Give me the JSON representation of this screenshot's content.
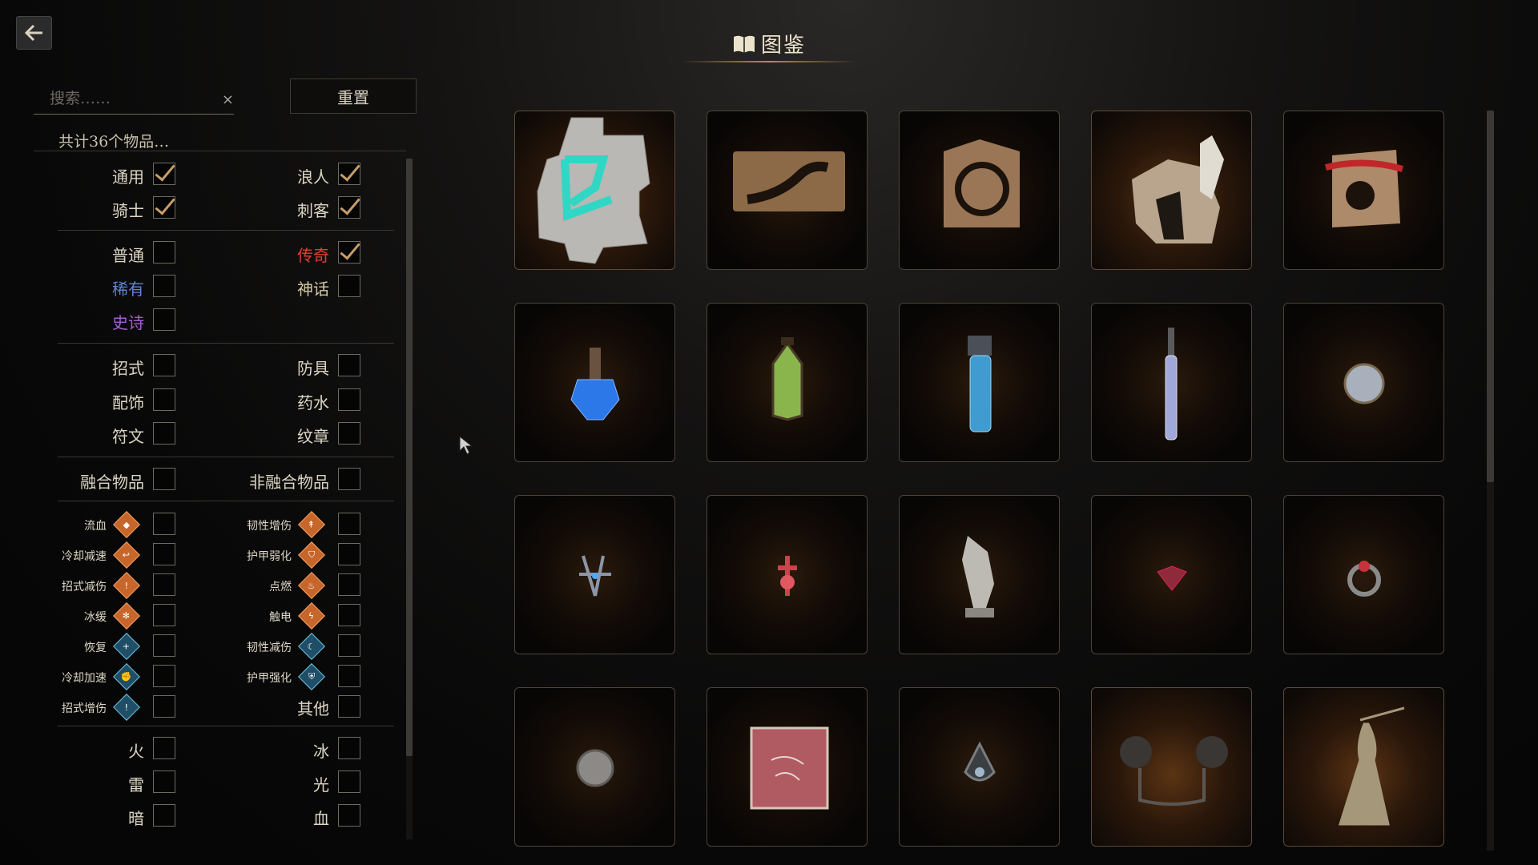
{
  "header": {
    "title": "图鉴",
    "title_icon": "book-icon",
    "back_icon": "back-arrow-icon"
  },
  "search": {
    "placeholder": "搜索……",
    "value": "",
    "clear_glyph": "×"
  },
  "reset_label": "重置",
  "count_label": "共计36个物品…",
  "filters": {
    "class": [
      {
        "label": "通用",
        "checked": true
      },
      {
        "label": "浪人",
        "checked": true
      },
      {
        "label": "骑士",
        "checked": true
      },
      {
        "label": "刺客",
        "checked": true
      }
    ],
    "rarity": [
      {
        "label": "普通",
        "checked": false
      },
      {
        "label": "传奇",
        "checked": true
      },
      {
        "label": "稀有",
        "checked": false
      },
      {
        "label": "神话",
        "checked": false
      },
      {
        "label": "史诗",
        "checked": false
      }
    ],
    "type": [
      {
        "label": "招式",
        "checked": false
      },
      {
        "label": "防具",
        "checked": false
      },
      {
        "label": "配饰",
        "checked": false
      },
      {
        "label": "药水",
        "checked": false
      },
      {
        "label": "符文",
        "checked": false
      },
      {
        "label": "纹章",
        "checked": false
      }
    ],
    "fusion": [
      {
        "label": "融合物品",
        "checked": false
      },
      {
        "label": "非融合物品",
        "checked": false
      }
    ],
    "effects": [
      {
        "label": "流血",
        "icon": "bleed-icon",
        "color": "#c7662b",
        "checked": false
      },
      {
        "label": "韧性增伤",
        "icon": "poise-damage-icon",
        "color": "#c7662b",
        "checked": false
      },
      {
        "label": "冷却减速",
        "icon": "cooldown-slow-icon",
        "color": "#c7662b",
        "checked": false
      },
      {
        "label": "护甲弱化",
        "icon": "armor-weaken-icon",
        "color": "#c7662b",
        "checked": false
      },
      {
        "label": "招式减伤",
        "icon": "skill-reduce-icon",
        "color": "#c7662b",
        "checked": false
      },
      {
        "label": "点燃",
        "icon": "ignite-icon",
        "color": "#c7662b",
        "checked": false
      },
      {
        "label": "冰缓",
        "icon": "frost-slow-icon",
        "color": "#c7662b",
        "checked": false
      },
      {
        "label": "触电",
        "icon": "shock-icon",
        "color": "#c7662b",
        "checked": false
      },
      {
        "label": "恢复",
        "icon": "heal-icon",
        "color": "#1f4e66",
        "checked": false
      },
      {
        "label": "韧性减伤",
        "icon": "poise-reduce-icon",
        "color": "#1f4e66",
        "checked": false
      },
      {
        "label": "冷却加速",
        "icon": "cooldown-speed-icon",
        "color": "#1f4e66",
        "checked": false
      },
      {
        "label": "护甲强化",
        "icon": "armor-boost-icon",
        "color": "#1f4e66",
        "checked": false
      },
      {
        "label": "招式增伤",
        "icon": "skill-boost-icon",
        "color": "#1f4e66",
        "checked": false
      },
      {
        "label": "其他",
        "checked": false
      }
    ],
    "elements": [
      {
        "label": "火",
        "checked": false
      },
      {
        "label": "冰",
        "checked": false
      },
      {
        "label": "雷",
        "checked": false
      },
      {
        "label": "光",
        "checked": false
      },
      {
        "label": "暗",
        "checked": false
      },
      {
        "label": "血",
        "checked": false
      }
    ]
  },
  "items": [
    {
      "icon": "rune-stone-icon",
      "glow": true
    },
    {
      "icon": "scroll-plank-icon",
      "glow": false
    },
    {
      "icon": "wooden-plaque-icon",
      "glow": false
    },
    {
      "icon": "broken-totem-icon",
      "glow": true
    },
    {
      "icon": "red-ribbon-plaque-icon",
      "glow": false
    },
    {
      "icon": "blue-potion-icon",
      "glow": false
    },
    {
      "icon": "lantern-potion-icon",
      "glow": false
    },
    {
      "icon": "tall-blue-vial-icon",
      "glow": false
    },
    {
      "icon": "syringe-vial-icon",
      "glow": false
    },
    {
      "icon": "silver-pendant-icon",
      "glow": false
    },
    {
      "icon": "crossed-blades-icon",
      "glow": false
    },
    {
      "icon": "red-cross-charm-icon",
      "glow": false
    },
    {
      "icon": "eagle-statue-icon",
      "glow": false
    },
    {
      "icon": "red-gem-brooch-icon",
      "glow": false
    },
    {
      "icon": "ruby-ring-icon",
      "glow": false
    },
    {
      "icon": "lion-medallion-icon",
      "glow": false
    },
    {
      "icon": "red-book-icon",
      "glow": false
    },
    {
      "icon": "teardrop-amulet-icon",
      "glow": false
    },
    {
      "icon": "flail-icon",
      "glow": true
    },
    {
      "icon": "goddess-statue-icon",
      "glow": true
    }
  ]
}
